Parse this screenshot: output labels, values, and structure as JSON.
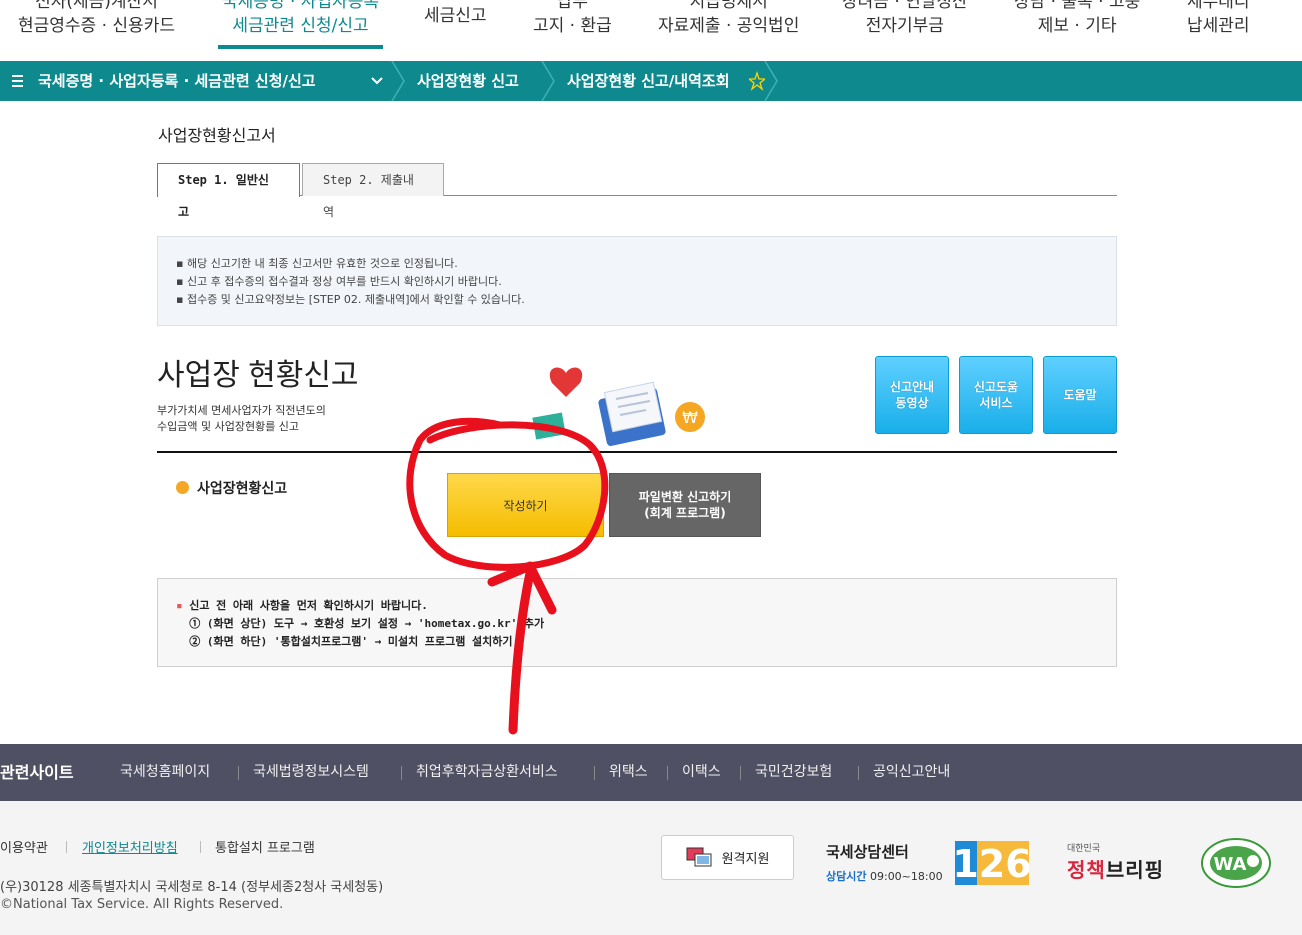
{
  "topnav": {
    "items": [
      {
        "line1": "전자(세금)계산서",
        "line2": "현금영수증 · 신용카드"
      },
      {
        "line1": "국세증명 · 사업자등록",
        "line2": "세금관련 신청/신고"
      },
      {
        "line1": "세금신고",
        "line2": ""
      },
      {
        "line1": "납부",
        "line2": "고지 · 환급"
      },
      {
        "line1": "지급명세서",
        "line2": "자료제출 · 공익법인"
      },
      {
        "line1": "장려금 · 연말정산",
        "line2": "전자기부금"
      },
      {
        "line1": "상담 · 불복 · 고충",
        "line2": "제보 · 기타"
      },
      {
        "line1": "세무대리",
        "line2": "납세관리"
      }
    ]
  },
  "breadcrumb": {
    "menu_icon": "menu-icon",
    "level1": "국세증명 · 사업자등록 · 세금관련 신청/신고",
    "level2": "사업장현황 신고",
    "level3": "사업장현황 신고/내역조회",
    "star_icon": "star-icon"
  },
  "page": {
    "title": "사업장현황신고서",
    "tabs": [
      "Step 1. 일반신고",
      "Step 2. 제출내역"
    ]
  },
  "notice": {
    "lines": [
      "해당 신고기한 내 최종 신고서만 유효한 것으로 인정됩니다.",
      "신고 후 접수증의 접수결과 정상 여부를 반드시 확인하시기 바랍니다.",
      "접수증 및 신고요약정보는 [STEP 02. 제출내역]에서 확인할 수 있습니다."
    ]
  },
  "main": {
    "heading": "사업장 현황신고",
    "desc_line1": "부가가치세 면세사업자가 직전년도의",
    "desc_line2": "수입금액 및 사업장현황를 신고",
    "help_buttons": [
      {
        "line1": "신고안내",
        "line2": "동영상"
      },
      {
        "line1": "신고도움",
        "line2": "서비스"
      },
      {
        "line1": "도움말",
        "line2": ""
      }
    ],
    "row_label": "사업장현황신고",
    "write_button": "작성하기",
    "file_button_line1": "파일변환 신고하기",
    "file_button_line2": "(회계 프로그램)"
  },
  "warning": {
    "line1": "신고 전 아래 사항을 먼저 확인하시기 바랍니다.",
    "line2": "① (화면 상단) 도구 → 호환성 보기 설정 → 'hometax.go.kr' 추가",
    "line3": "② (화면 하단) '통합설치프로그램' → 미설치 프로그램 설치하기"
  },
  "footer": {
    "related_title": "관련사이트",
    "related_links": [
      "국세청홈페이지",
      "국세법령정보시스템",
      "취업후학자금상환서비스",
      "위택스",
      "이택스",
      "국민건강보험",
      "공익신고안내"
    ],
    "bottom_links": [
      "이용약관",
      "개인정보처리방침",
      "통합설치 프로그램"
    ],
    "address": "(우)30128 세종특별자치시 국세청로 8-14 (정부세종2청사 국세청동)",
    "copyright": "©National Tax Service. All Rights Reserved.",
    "remote_support": "원격지원",
    "center_title": "국세상담센터",
    "center_hours_label": "상담시간",
    "center_hours": "09:00~18:00",
    "center_number": "126",
    "brief_small": "대한민국",
    "brief_big_1": "정책",
    "brief_big_2": "브리핑",
    "wa_label": "WA"
  },
  "colors": {
    "brand_teal": "#0e8a8f",
    "write_button": "#f5bd00",
    "help_button": "#19aee9",
    "annotation_red": "#e8101c"
  }
}
